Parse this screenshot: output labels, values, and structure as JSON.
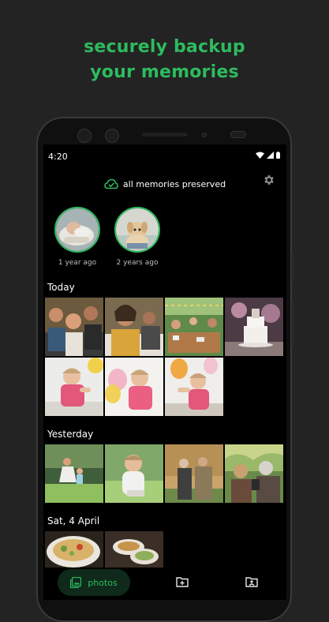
{
  "headline": {
    "line1": "securely backup",
    "line2": "your memories"
  },
  "status_bar": {
    "time": "4:20"
  },
  "banner": {
    "text": "all memories preserved",
    "icon": "cloud-check-icon"
  },
  "settings": {
    "icon": "gear-icon"
  },
  "memories": [
    {
      "label": "1 year ago"
    },
    {
      "label": "2 years ago"
    }
  ],
  "sections": [
    {
      "title": "Today"
    },
    {
      "title": "Yesterday"
    },
    {
      "title": "Sat, 4 April"
    }
  ],
  "bottom_nav": {
    "active_label": "photos",
    "icons": [
      "photos-icon",
      "add-folder-icon",
      "shared-folder-icon"
    ]
  },
  "colors": {
    "accent": "#2dbb5e",
    "background": "#232323",
    "screen": "#000000"
  }
}
